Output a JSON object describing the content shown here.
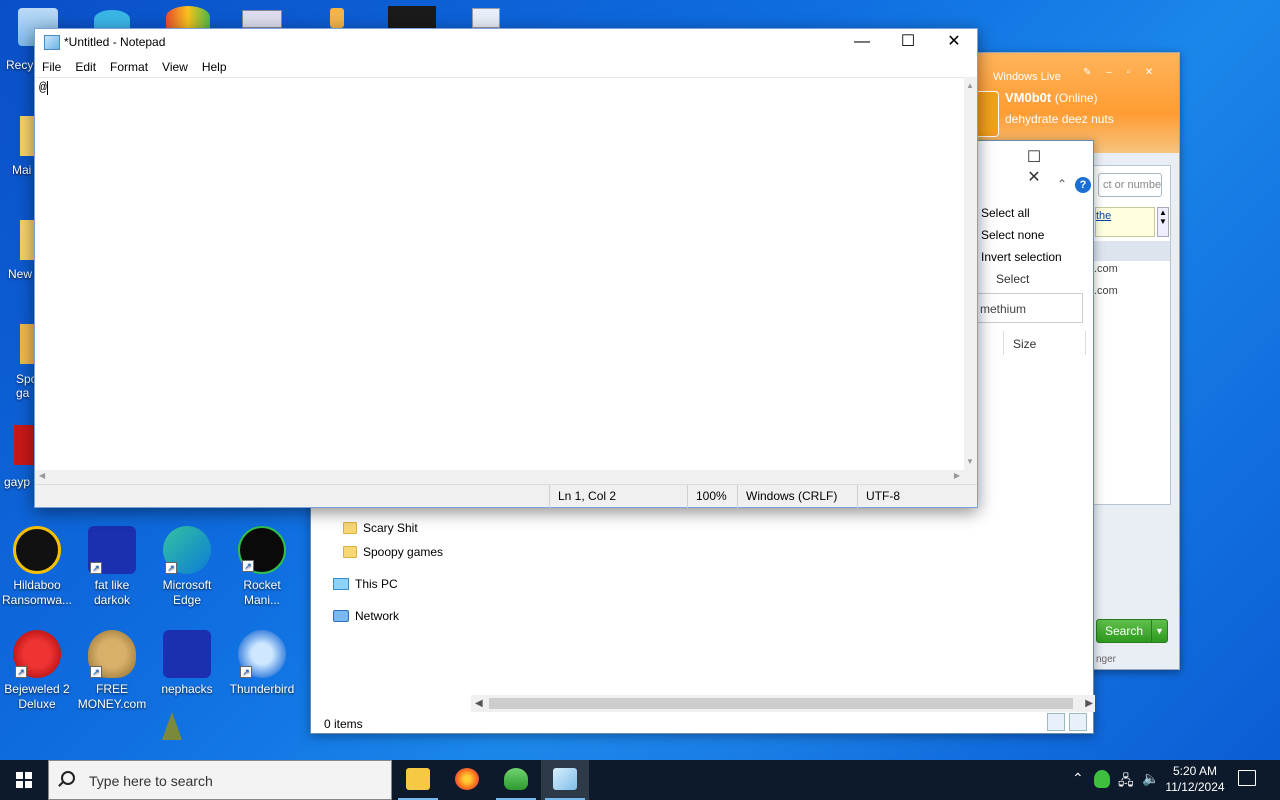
{
  "desktop": {
    "icons": [
      {
        "label": "Recy",
        "x": "partial"
      },
      {
        "label": "Mai"
      },
      {
        "label": "New"
      },
      {
        "label": "Spo ga"
      },
      {
        "label": "gayp"
      },
      {
        "label": "Hildaboo Ransomwa..."
      },
      {
        "label": "fat like darkok"
      },
      {
        "label": "Microsoft Edge"
      },
      {
        "label": "Rocket Mani..."
      },
      {
        "label": "Bejeweled 2 Deluxe"
      },
      {
        "label": "FREE MONEY.com"
      },
      {
        "label": "nephacks"
      },
      {
        "label": "Thunderbird"
      }
    ]
  },
  "messenger": {
    "title": "Windows Live",
    "display_name": "VM0b0t",
    "status": "(Online)",
    "personal_message": "dehydrate deez nuts",
    "search_placeholder": "ct or numbe",
    "link_text": "the",
    "contact_suffix_1": ".com",
    "contact_suffix_2": ".com",
    "search_button": "Search",
    "footer": "nger"
  },
  "explorer": {
    "ribbon": {
      "select_all": "Select all",
      "select_none": "Select none",
      "invert_selection": "Invert selection",
      "group_label": "Select"
    },
    "search_text": "methium",
    "column_size": "Size",
    "nav": {
      "scary": "Scary Shit",
      "spoopy": "Spoopy games",
      "this_pc": "This PC",
      "network": "Network"
    },
    "status": "0 items"
  },
  "notepad": {
    "title": "*Untitled - Notepad",
    "menu": [
      "File",
      "Edit",
      "Format",
      "View",
      "Help"
    ],
    "content": "@",
    "status": {
      "position": "Ln 1, Col 2",
      "zoom": "100%",
      "line_ending": "Windows (CRLF)",
      "encoding": "UTF-8"
    }
  },
  "taskbar": {
    "search_placeholder": "Type here to search",
    "time": "5:20 AM",
    "date": "11/12/2024"
  }
}
